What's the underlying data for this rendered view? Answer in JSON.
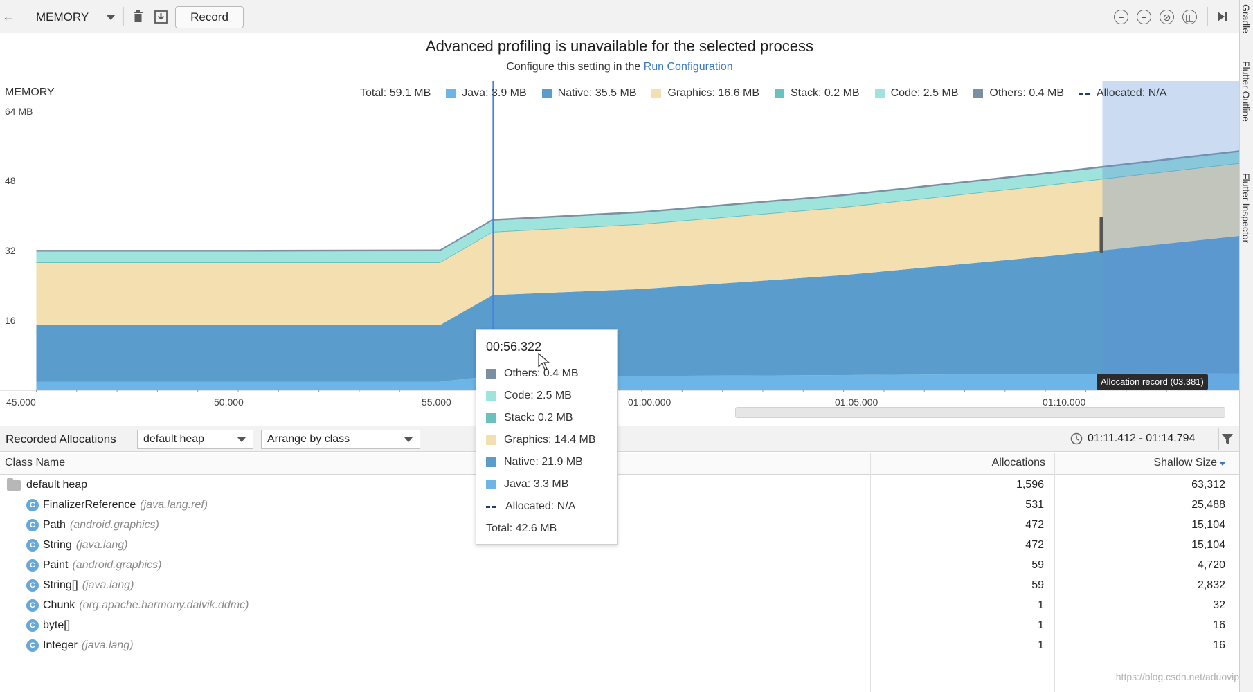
{
  "toolbar": {
    "profiler_select": "MEMORY",
    "record_label": "Record"
  },
  "side_tabs": [
    "Gradle",
    "Flutter Outline",
    "Flutter Inspector"
  ],
  "banner": {
    "title": "Advanced profiling is unavailable for the selected process",
    "sub_prefix": "Configure this setting in the",
    "sub_link": "Run Configuration"
  },
  "chart": {
    "label": "MEMORY",
    "total_label": "Total: 59.1 MB",
    "legend": [
      {
        "label": "Java: 3.9 MB",
        "color": "#6cb5e6"
      },
      {
        "label": "Native: 35.5 MB",
        "color": "#5a9ccc"
      },
      {
        "label": "Graphics: 16.6 MB",
        "color": "#f3dfb0"
      },
      {
        "label": "Stack: 0.2 MB",
        "color": "#6ac2bf"
      },
      {
        "label": "Code: 2.5 MB",
        "color": "#9ee3dc"
      },
      {
        "label": "Others: 0.4 MB",
        "color": "#7b8fa3"
      }
    ],
    "allocated_label": "Allocated: N/A",
    "y_ticks": [
      "64 MB",
      "48",
      "32",
      "16"
    ],
    "x_ticks": [
      "45.000",
      "50.000",
      "55.000",
      "01:00.000",
      "01:05.000",
      "01:10.000"
    ],
    "selection_label": "Allocation record (03.381)"
  },
  "chart_data": {
    "type": "area",
    "title": "MEMORY",
    "ylabel": "",
    "ylim": [
      0,
      64
    ],
    "x": [
      45.0,
      50.0,
      55.0,
      56.3,
      60.0,
      65.0,
      70.0,
      74.8
    ],
    "series": [
      {
        "name": "Java",
        "values": [
          2.0,
          2.0,
          2.0,
          3.3,
          3.3,
          3.5,
          3.8,
          3.9
        ]
      },
      {
        "name": "Native",
        "values": [
          13.0,
          13.0,
          13.0,
          18.6,
          20.0,
          23.0,
          27.0,
          31.6
        ]
      },
      {
        "name": "Graphics",
        "values": [
          14.3,
          14.3,
          14.3,
          14.4,
          14.8,
          15.5,
          16.2,
          16.6
        ]
      },
      {
        "name": "Stack",
        "values": [
          0.2,
          0.2,
          0.2,
          0.2,
          0.2,
          0.2,
          0.2,
          0.2
        ]
      },
      {
        "name": "Code",
        "values": [
          2.4,
          2.4,
          2.5,
          2.5,
          2.5,
          2.5,
          2.5,
          2.5
        ]
      },
      {
        "name": "Others",
        "values": [
          0.4,
          0.4,
          0.4,
          0.4,
          0.4,
          0.4,
          0.4,
          0.4
        ]
      }
    ]
  },
  "tooltip": {
    "time": "00:56.322",
    "rows": [
      {
        "label": "Others: 0.4 MB",
        "color": "#7b8fa3"
      },
      {
        "label": "Code: 2.5 MB",
        "color": "#9ee3dc"
      },
      {
        "label": "Stack: 0.2 MB",
        "color": "#6ac2bf"
      },
      {
        "label": "Graphics: 14.4 MB",
        "color": "#f3dfb0"
      },
      {
        "label": "Native: 21.9 MB",
        "color": "#5a9ccc"
      },
      {
        "label": "Java: 3.3 MB",
        "color": "#6cb5e6"
      }
    ],
    "allocated": "Allocated: N/A",
    "total": "Total: 42.6 MB"
  },
  "allocations_bar": {
    "title": "Recorded Allocations",
    "heap_select": "default heap",
    "arrange_select": "Arrange by class",
    "time_range": "01:11.412 - 01:14.794"
  },
  "table": {
    "headers": {
      "class_name": "Class Name",
      "allocations": "Allocations",
      "shallow_size": "Shallow Size"
    },
    "root": {
      "name": "default heap",
      "allocations": "1,596",
      "shallow_size": "63,312"
    },
    "rows": [
      {
        "name": "FinalizerReference",
        "pkg": "(java.lang.ref)",
        "allocations": "531",
        "shallow_size": "25,488"
      },
      {
        "name": "Path",
        "pkg": "(android.graphics)",
        "allocations": "472",
        "shallow_size": "15,104"
      },
      {
        "name": "String",
        "pkg": "(java.lang)",
        "allocations": "472",
        "shallow_size": "15,104"
      },
      {
        "name": "Paint",
        "pkg": "(android.graphics)",
        "allocations": "59",
        "shallow_size": "4,720"
      },
      {
        "name": "String[]",
        "pkg": "(java.lang)",
        "allocations": "59",
        "shallow_size": "2,832"
      },
      {
        "name": "Chunk",
        "pkg": "(org.apache.harmony.dalvik.ddmc)",
        "allocations": "1",
        "shallow_size": "32"
      },
      {
        "name": "byte[]",
        "pkg": "",
        "allocations": "1",
        "shallow_size": "16"
      },
      {
        "name": "Integer",
        "pkg": "(java.lang)",
        "allocations": "1",
        "shallow_size": "16"
      }
    ]
  },
  "watermark": "https://blog.csdn.net/aduovip"
}
